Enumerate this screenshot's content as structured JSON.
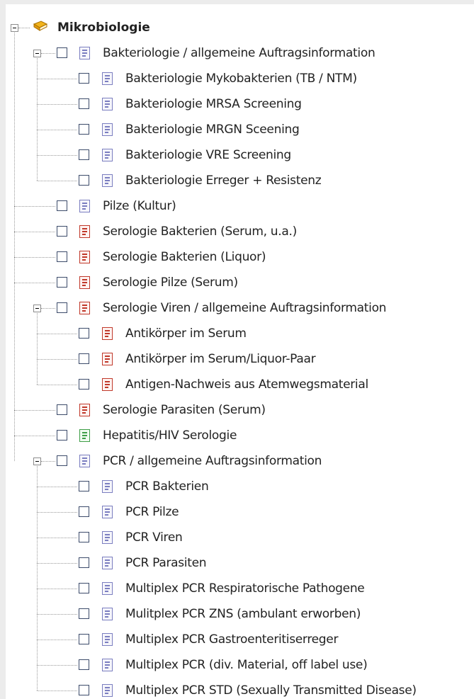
{
  "colors": {
    "background": "#ececec",
    "panel": "#ffffff",
    "doc_blue": "#7b7ec0",
    "doc_red": "#c0392b",
    "doc_green": "#3f9e48",
    "book_yellow": "#f2b41c"
  },
  "tree": {
    "root": {
      "label": "Mikrobiologie",
      "icon": "book-icon",
      "expanded": true
    },
    "groups": [
      {
        "label": "Bakteriologie / allgemeine Auftragsinformation",
        "icon": "document-blue-icon",
        "checked": false,
        "expanded": true,
        "children": [
          {
            "label": "Bakteriologie Mykobakterien (TB / NTM)",
            "icon": "document-blue-icon",
            "checked": false
          },
          {
            "label": "Bakteriologie MRSA Screening",
            "icon": "document-blue-icon",
            "checked": false
          },
          {
            "label": "Bakteriologie MRGN Sceening",
            "icon": "document-blue-icon",
            "checked": false
          },
          {
            "label": "Bakteriologie VRE Screening",
            "icon": "document-blue-icon",
            "checked": false
          },
          {
            "label": "Bakteriologie Erreger + Resistenz",
            "icon": "document-blue-icon",
            "checked": false
          }
        ]
      },
      {
        "label": "Pilze (Kultur)",
        "icon": "document-blue-icon",
        "checked": false,
        "children": []
      },
      {
        "label": "Serologie Bakterien (Serum, u.a.)",
        "icon": "document-red-icon",
        "checked": false,
        "children": []
      },
      {
        "label": "Serologie Bakterien (Liquor)",
        "icon": "document-red-icon",
        "checked": false,
        "children": []
      },
      {
        "label": "Serologie Pilze (Serum)",
        "icon": "document-red-icon",
        "checked": false,
        "children": []
      },
      {
        "label": "Serologie Viren / allgemeine Auftragsinformation",
        "icon": "document-red-icon",
        "checked": false,
        "expanded": true,
        "children": [
          {
            "label": "Antikörper im Serum",
            "icon": "document-red-icon",
            "checked": false
          },
          {
            "label": "Antikörper im Serum/Liquor-Paar",
            "icon": "document-red-icon",
            "checked": false
          },
          {
            "label": "Antigen-Nachweis aus Atemwegsmaterial",
            "icon": "document-red-icon",
            "checked": false
          }
        ]
      },
      {
        "label": "Serologie Parasiten (Serum)",
        "icon": "document-red-icon",
        "checked": false,
        "children": []
      },
      {
        "label": "Hepatitis/HIV Serologie",
        "icon": "document-green-icon",
        "checked": false,
        "children": []
      },
      {
        "label": "PCR / allgemeine Auftragsinformation",
        "icon": "document-blue-icon",
        "checked": false,
        "expanded": true,
        "children": [
          {
            "label": "PCR Bakterien",
            "icon": "document-blue-icon",
            "checked": false
          },
          {
            "label": "PCR Pilze",
            "icon": "document-blue-icon",
            "checked": false
          },
          {
            "label": "PCR Viren",
            "icon": "document-blue-icon",
            "checked": false
          },
          {
            "label": "PCR Parasiten",
            "icon": "document-blue-icon",
            "checked": false
          },
          {
            "label": "Multiplex PCR Respiratorische Pathogene",
            "icon": "document-blue-icon",
            "checked": false
          },
          {
            "label": "Mulitplex PCR ZNS (ambulant erworben)",
            "icon": "document-blue-icon",
            "checked": false
          },
          {
            "label": "Multiplex PCR Gastroenteritiserreger",
            "icon": "document-blue-icon",
            "checked": false
          },
          {
            "label": "Multiplex PCR (div. Material, off label use)",
            "icon": "document-blue-icon",
            "checked": false
          },
          {
            "label": "Multiplex PCR STD (Sexually Transmitted Disease)",
            "icon": "document-blue-icon",
            "checked": false
          }
        ]
      }
    ]
  }
}
